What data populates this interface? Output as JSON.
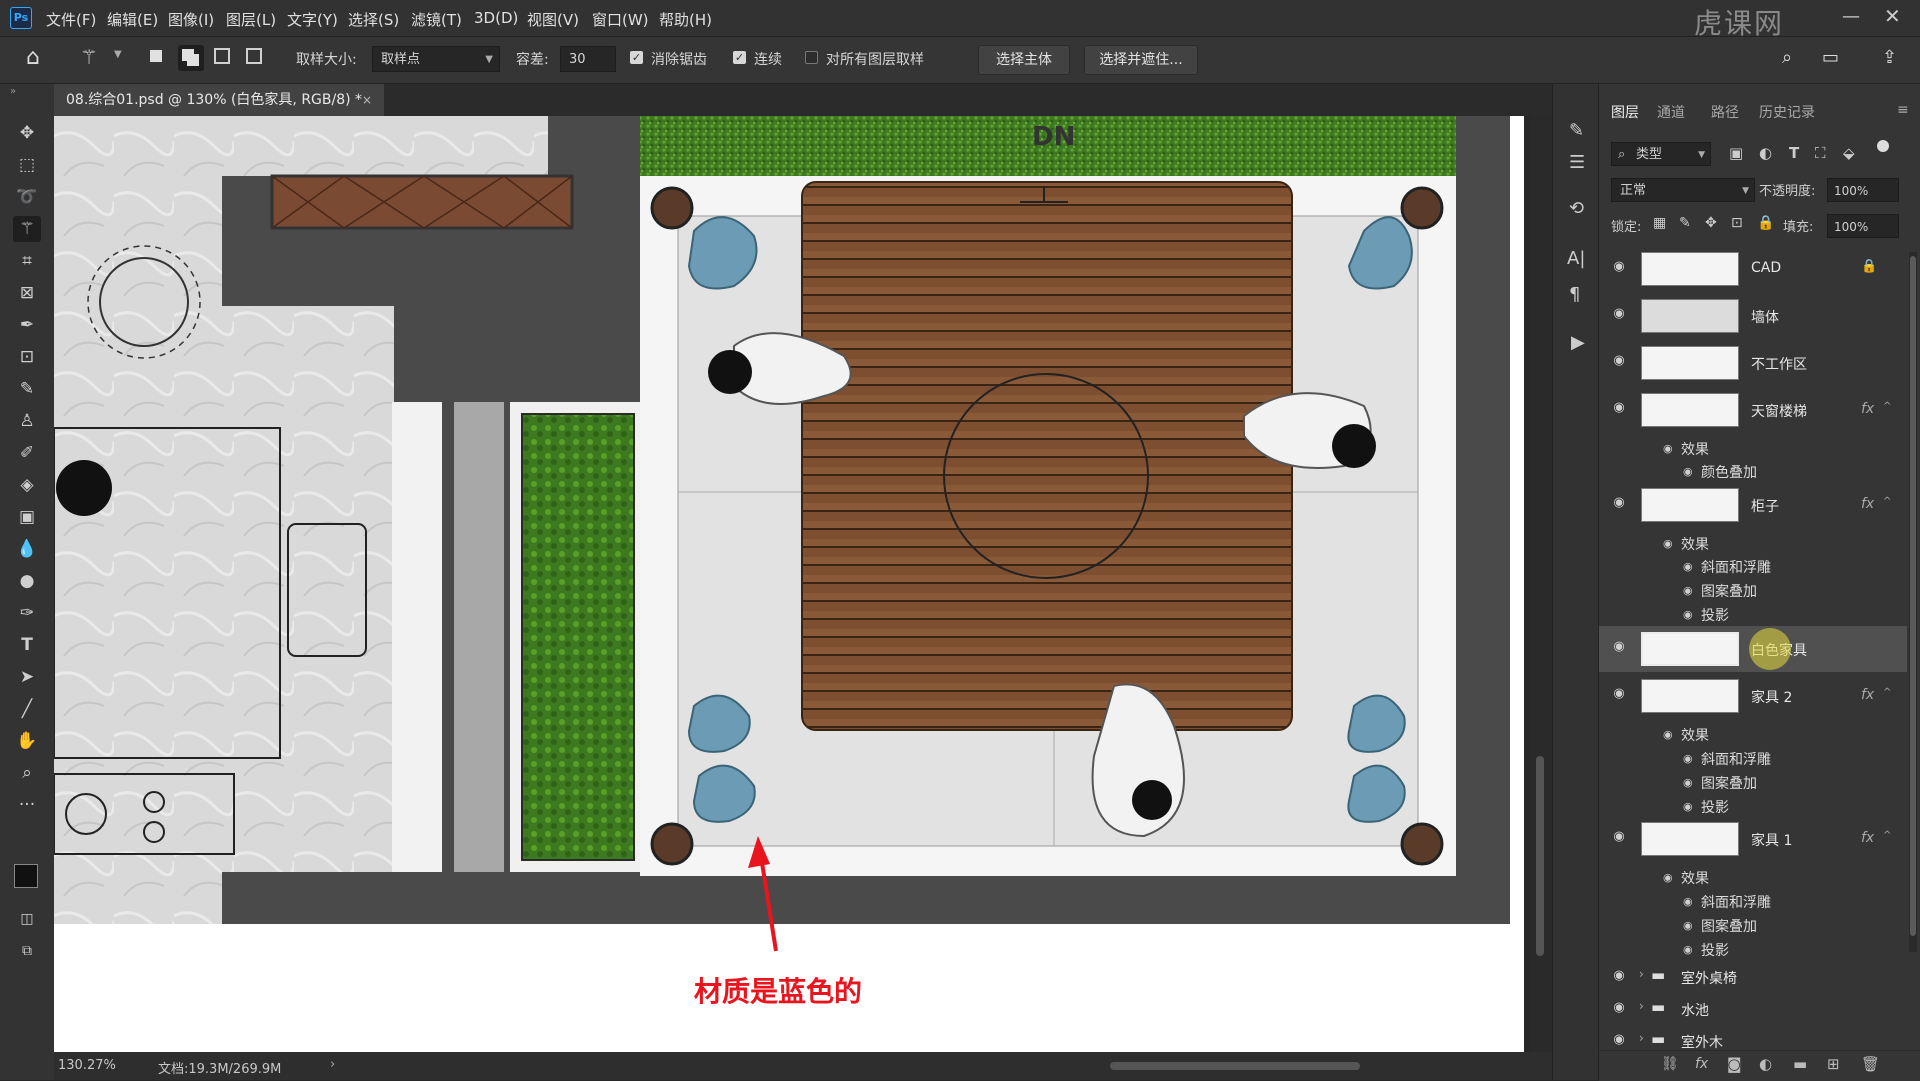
{
  "menubar": {
    "logo": "Ps",
    "items": [
      "文件(F)",
      "编辑(E)",
      "图像(I)",
      "图层(L)",
      "文字(Y)",
      "选择(S)",
      "滤镜(T)",
      "3D(D)",
      "视图(V)",
      "窗口(W)",
      "帮助(H)"
    ]
  },
  "options": {
    "sample_size_label": "取样大小:",
    "sample_size_value": "取样点",
    "tolerance_label": "容差:",
    "tolerance_value": "30",
    "antialias_label": "消除锯齿",
    "contiguous_label": "连续",
    "all_layers_label": "对所有图层取样",
    "select_subject": "选择主体",
    "select_and_mask": "选择并遮住..."
  },
  "document": {
    "tab_title": "08.综合01.psd @ 130% (白色家具, RGB/8) *",
    "annotation_text": "材质是蓝色的",
    "dn_label": "DN",
    "annotation_color": "#e8141e"
  },
  "status": {
    "zoom": "130.27%",
    "doc_info": "文档:19.3M/269.9M"
  },
  "panel": {
    "tabs": [
      "图层",
      "通道",
      "路径",
      "历史记录"
    ],
    "filter_kind": "类型",
    "blend_mode": "正常",
    "opacity_label": "不透明度:",
    "opacity_value": "100%",
    "lock_label": "锁定:",
    "fill_label": "填充:",
    "fill_value": "100%",
    "effects_label": "效果",
    "layers": [
      {
        "name": "CAD",
        "locked": true
      },
      {
        "name": "墙体"
      },
      {
        "name": "不工作区"
      },
      {
        "name": "天窗楼梯",
        "fx": "fx",
        "effects": [
          "颜色叠加"
        ]
      },
      {
        "name": "柜子",
        "fx": "fx",
        "effects": [
          "斜面和浮雕",
          "图案叠加",
          "投影"
        ]
      },
      {
        "name": "白色家具",
        "selected": true
      },
      {
        "name": "家具 2",
        "fx": "fx",
        "effects": [
          "斜面和浮雕",
          "图案叠加",
          "投影"
        ]
      },
      {
        "name": "家具 1",
        "fx": "fx",
        "effects": [
          "斜面和浮雕",
          "图案叠加",
          "投影"
        ]
      }
    ],
    "groups": [
      "室外桌椅",
      "水池",
      "室外木"
    ]
  },
  "watermark": "虎课网",
  "icons": [
    "home-icon",
    "magic-wand-icon",
    "move-icon",
    "marquee-icon",
    "lasso-icon",
    "quick-select-icon",
    "crop-icon",
    "frame-icon",
    "eyedropper-icon",
    "patch-icon",
    "brush-icon",
    "stamp-icon",
    "history-brush-icon",
    "eraser-icon",
    "gradient-icon",
    "blur-icon",
    "dodge-icon",
    "pen-icon",
    "type-icon",
    "path-select-icon",
    "line-icon",
    "hand-icon",
    "zoom-icon",
    "more-icon",
    "eye-icon",
    "lock-icon",
    "folder-icon",
    "search-icon"
  ]
}
